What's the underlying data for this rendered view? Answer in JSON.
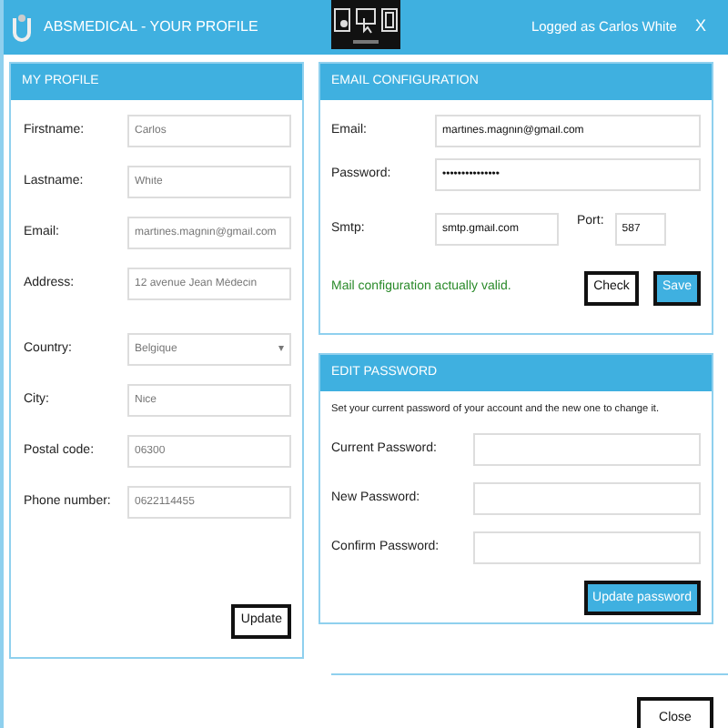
{
  "window": {
    "title": "ABSMEDICAL - YOUR PROFILE",
    "user": "Logged as Carlos White",
    "close": "X"
  },
  "profile": {
    "title": "MY PROFILE",
    "fields": [
      {
        "label": "Firstname:",
        "value": "Carlos",
        "kind": "text"
      },
      {
        "label": "Lastname:",
        "value": "White",
        "kind": "text"
      },
      {
        "label": "Email:",
        "value": "martines.magnin@gmail.com",
        "kind": "text"
      },
      {
        "label": "Address:",
        "value": "12 avenue Jean Médecin",
        "kind": "text"
      },
      {
        "label": "Country:",
        "value": "Belgique",
        "kind": "select",
        "caret": "▾"
      },
      {
        "label": "City:",
        "value": "Nice",
        "kind": "text"
      },
      {
        "label": "Postal code:",
        "value": "06300",
        "kind": "text"
      },
      {
        "label": "Phone number:",
        "value": "0622114455",
        "kind": "text"
      }
    ],
    "button": "Update"
  },
  "email_config": {
    "title": "EMAIL CONFIGURATION",
    "email_label": "Email:",
    "email": "martines.magnin@gmail.com",
    "password_label": "Password:",
    "password": "•••••••••••••••",
    "smtp_label": "Smtp:",
    "smtp": "smtp.gmail.com",
    "port_label": "Port:",
    "port": "587",
    "status": "Mail configuration actually valid.",
    "buttons": [
      {
        "label": "Check",
        "kind": "outline"
      },
      {
        "label": "Save",
        "kind": "primary"
      }
    ]
  },
  "edit_password": {
    "title": "EDIT PASSWORD",
    "intro": "Set your current password of your account and the new one to change it.",
    "fields": [
      {
        "label": "Current Password:"
      },
      {
        "label": "New Password:"
      },
      {
        "label": "Confirm Password:"
      }
    ],
    "button": "Update password"
  },
  "close_button": "Close"
}
